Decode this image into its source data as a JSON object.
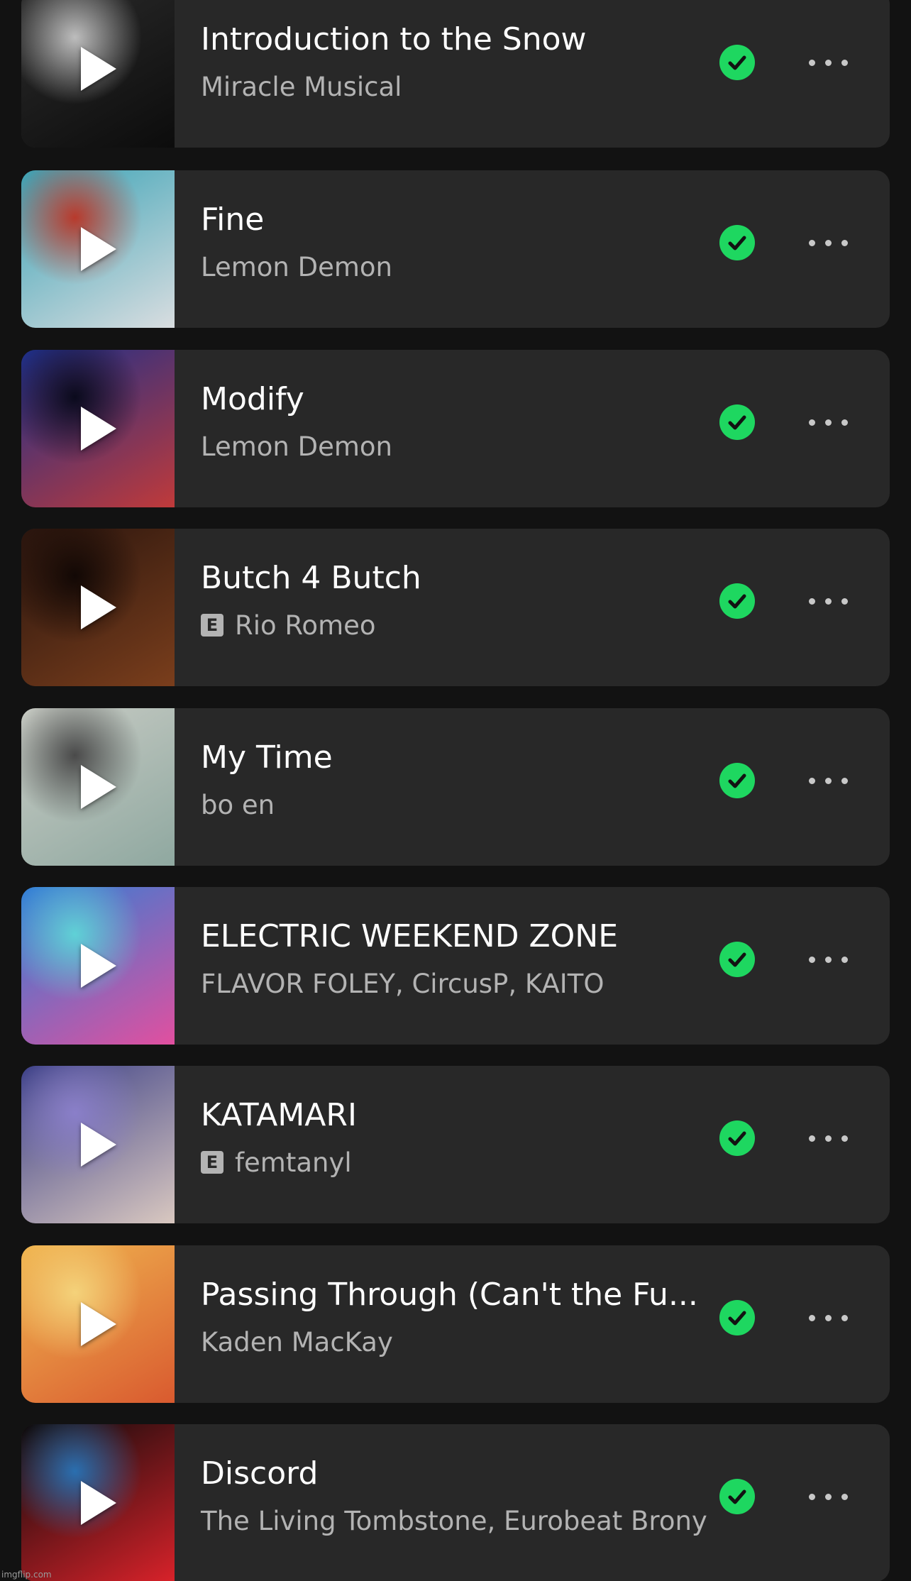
{
  "tracks": [
    {
      "title": "Introduction to the Snow",
      "artist": "Miracle Musical",
      "explicit": false,
      "downloaded": true,
      "art_colors": [
        "#2b2b2b",
        "#0c0c0c",
        "#bdbdbd"
      ]
    },
    {
      "title": "Fine",
      "artist": "Lemon Demon",
      "explicit": false,
      "downloaded": true,
      "art_colors": [
        "#3aa3b6",
        "#d9dde0",
        "#b83a2c"
      ]
    },
    {
      "title": "Modify",
      "artist": "Lemon Demon",
      "explicit": false,
      "downloaded": true,
      "art_colors": [
        "#1c2f8a",
        "#c03a3a",
        "#0a0a1c"
      ]
    },
    {
      "title": "Butch 4 Butch",
      "artist": "Rio Romeo",
      "explicit": true,
      "downloaded": true,
      "art_colors": [
        "#2a150e",
        "#7a3e1c",
        "#120805"
      ]
    },
    {
      "title": "My Time",
      "artist": "bo en",
      "explicit": false,
      "downloaded": true,
      "art_colors": [
        "#c9ccc5",
        "#8fa8a0",
        "#4a4a4a"
      ]
    },
    {
      "title": "ELECTRIC WEEKEND ZONE",
      "artist": "FLAVOR FOLEY, CircusP, KAITO",
      "explicit": false,
      "downloaded": true,
      "art_colors": [
        "#2f7fd6",
        "#e24f9f",
        "#5fd1d6"
      ]
    },
    {
      "title": "KATAMARI",
      "artist": "femtanyl",
      "explicit": true,
      "downloaded": true,
      "art_colors": [
        "#3b3f86",
        "#d9c8c0",
        "#8a7fc9"
      ]
    },
    {
      "title": "Passing Through (Can't the Fu...",
      "artist": "Kaden MacKay",
      "explicit": false,
      "downloaded": true,
      "art_colors": [
        "#f0b650",
        "#d95a2f",
        "#f4d27a"
      ]
    },
    {
      "title": "Discord",
      "artist": "The Living Tombstone, Eurobeat Brony",
      "explicit": false,
      "downloaded": true,
      "art_colors": [
        "#0a0a0a",
        "#d8222a",
        "#2a6fb0"
      ]
    }
  ],
  "explicit_label": "E",
  "watermark": "imgflip.com",
  "colors": {
    "background": "#121212",
    "card": "#282828",
    "accent_green": "#1ed760",
    "secondary_text": "#b3b3b3"
  }
}
